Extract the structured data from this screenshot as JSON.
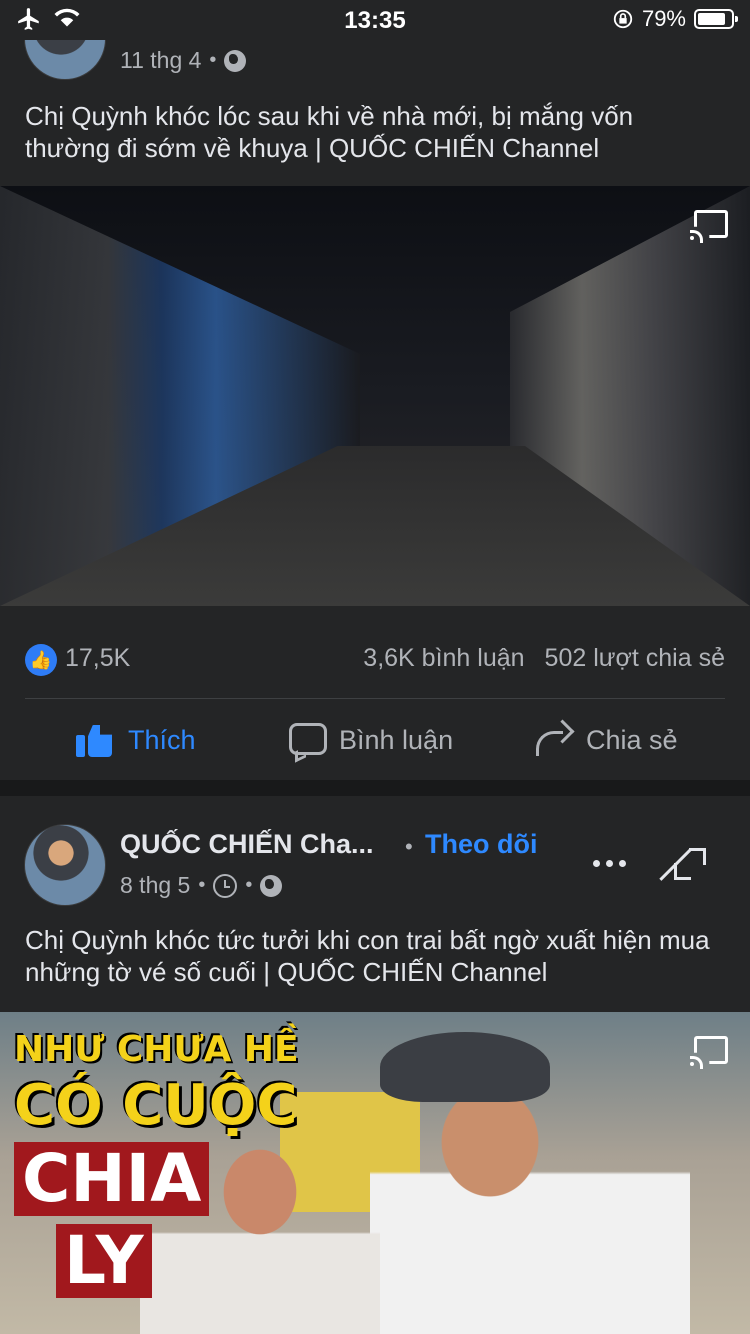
{
  "status_bar": {
    "time": "13:35",
    "battery_pct": "79%",
    "battery_level": 0.79
  },
  "post1": {
    "date": "11 thg 4",
    "text": "Chị Quỳnh khóc lóc sau khi về nhà mới, bị mắng vốn thường đi sớm về khuya | QUỐC CHIẾN Channel",
    "likes": "17,5K",
    "comments": "3,6K bình luận",
    "shares": "502 lượt chia sẻ"
  },
  "actions": {
    "like": "Thích",
    "comment": "Bình luận",
    "share": "Chia sẻ"
  },
  "post2": {
    "author": "QUỐC CHIẾN Cha...",
    "follow": "Theo dõi",
    "date": "8 thg 5",
    "text": "Chị Quỳnh khóc tức tưởi khi con trai bất ngờ xuất hiện mua những tờ vé số cuối | QUỐC CHIẾN Channel",
    "thumb_text": [
      "NHƯ CHƯA HỀ",
      "CÓ CUỘC",
      "CHIA",
      "LY"
    ]
  },
  "colors": {
    "accent": "#2e89ff",
    "card": "#242526",
    "bg": "#18191a"
  },
  "icons": [
    "airplane-icon",
    "wifi-icon",
    "rotation-lock-icon",
    "battery-icon",
    "globe-icon",
    "clock-icon",
    "cast-icon",
    "like-icon",
    "comment-icon",
    "share-icon",
    "more-icon",
    "expand-icon"
  ]
}
